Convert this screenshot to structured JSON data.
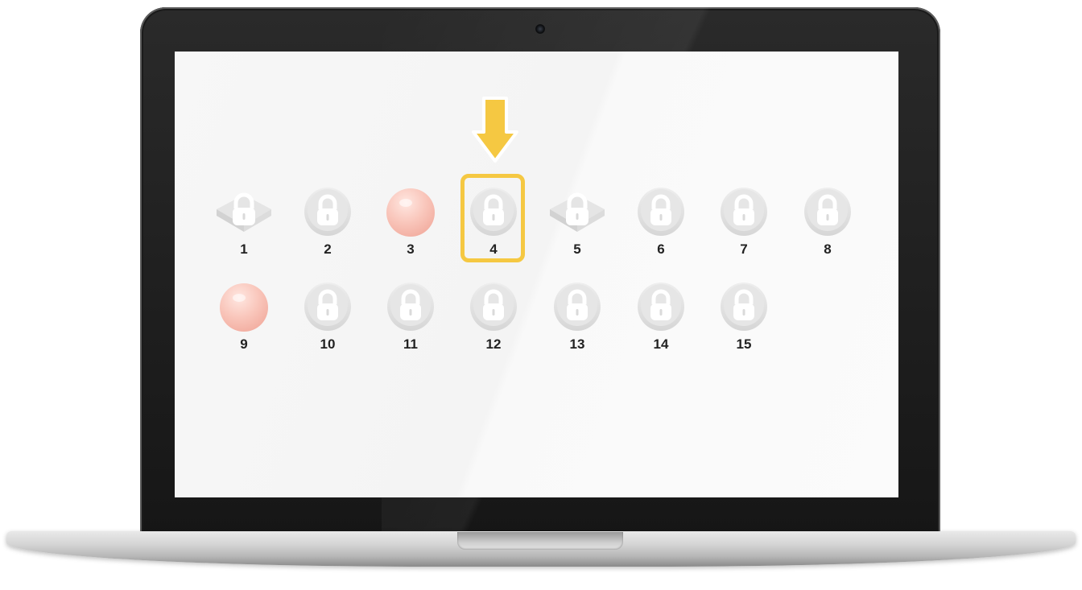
{
  "levels": [
    {
      "number": "1",
      "type": "book-locked",
      "icon": "locked-book-icon"
    },
    {
      "number": "2",
      "type": "locked",
      "icon": "padlock-icon"
    },
    {
      "number": "3",
      "type": "sphere",
      "icon": "sphere-icon"
    },
    {
      "number": "4",
      "type": "locked",
      "icon": "padlock-icon"
    },
    {
      "number": "5",
      "type": "book-locked",
      "icon": "locked-book-icon"
    },
    {
      "number": "6",
      "type": "locked",
      "icon": "padlock-icon"
    },
    {
      "number": "7",
      "type": "locked",
      "icon": "padlock-icon"
    },
    {
      "number": "8",
      "type": "locked",
      "icon": "padlock-icon"
    },
    {
      "number": "9",
      "type": "sphere",
      "icon": "sphere-icon"
    },
    {
      "number": "10",
      "type": "locked",
      "icon": "padlock-icon"
    },
    {
      "number": "11",
      "type": "locked",
      "icon": "padlock-icon"
    },
    {
      "number": "12",
      "type": "locked",
      "icon": "padlock-icon"
    },
    {
      "number": "13",
      "type": "locked",
      "icon": "padlock-icon"
    },
    {
      "number": "14",
      "type": "locked",
      "icon": "padlock-icon"
    },
    {
      "number": "15",
      "type": "locked",
      "icon": "padlock-icon"
    }
  ],
  "highlighted_level": "4",
  "colors": {
    "highlight": "#f5c842",
    "arrow": "#f5c842",
    "lock_bg": "#e2e2e2",
    "sphere": "#f8c5bb",
    "label": "#222222"
  }
}
